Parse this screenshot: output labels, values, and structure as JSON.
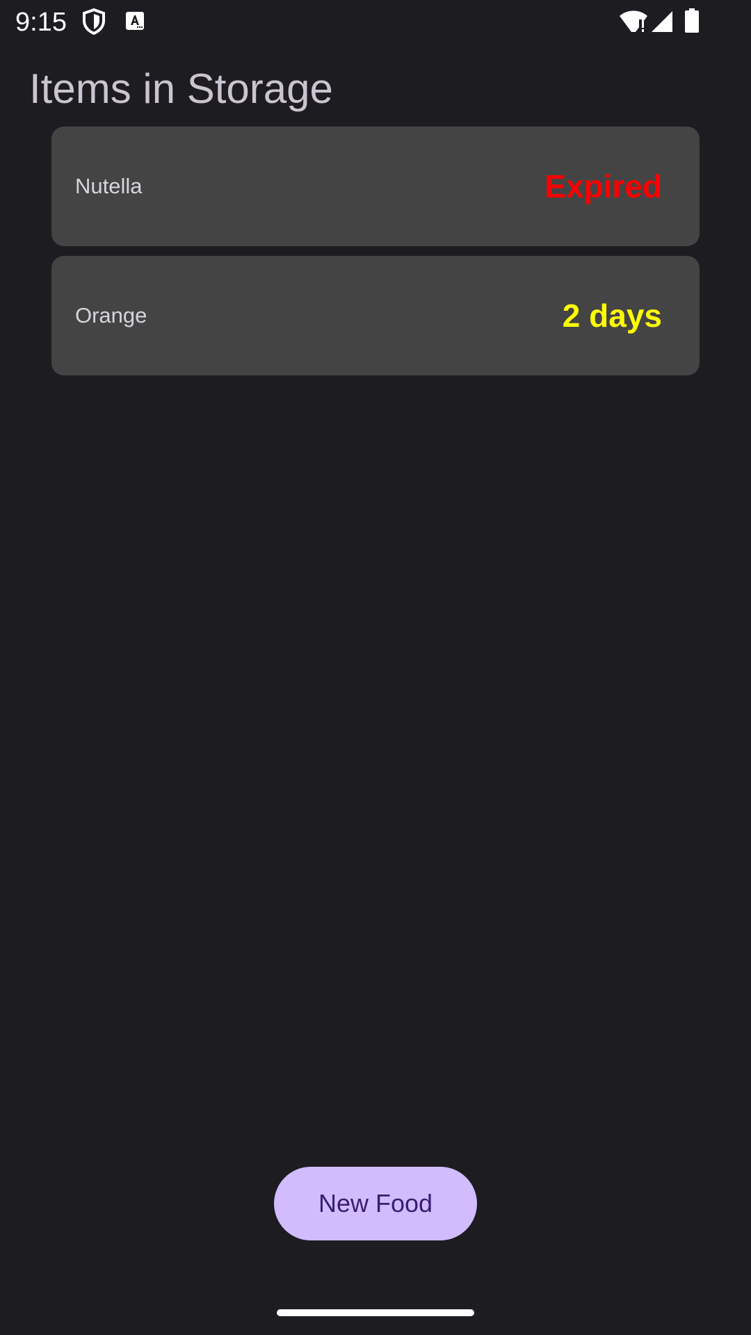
{
  "status_bar": {
    "time": "9:15",
    "icons": [
      "shield-icon",
      "a-icon",
      "wifi-icon",
      "signal-icon",
      "battery-icon"
    ]
  },
  "header": {
    "title": "Items in Storage"
  },
  "items": [
    {
      "name": "Nutella",
      "status": "Expired",
      "status_color": "#ff0000"
    },
    {
      "name": "Orange",
      "status": "2 days",
      "status_color": "#ffff00"
    }
  ],
  "actions": {
    "new_food_label": "New Food"
  },
  "colors": {
    "background": "#1d1c21",
    "card": "#444444",
    "button": "#d0bcff",
    "button_text": "#381e72",
    "title": "#cac4d0"
  }
}
